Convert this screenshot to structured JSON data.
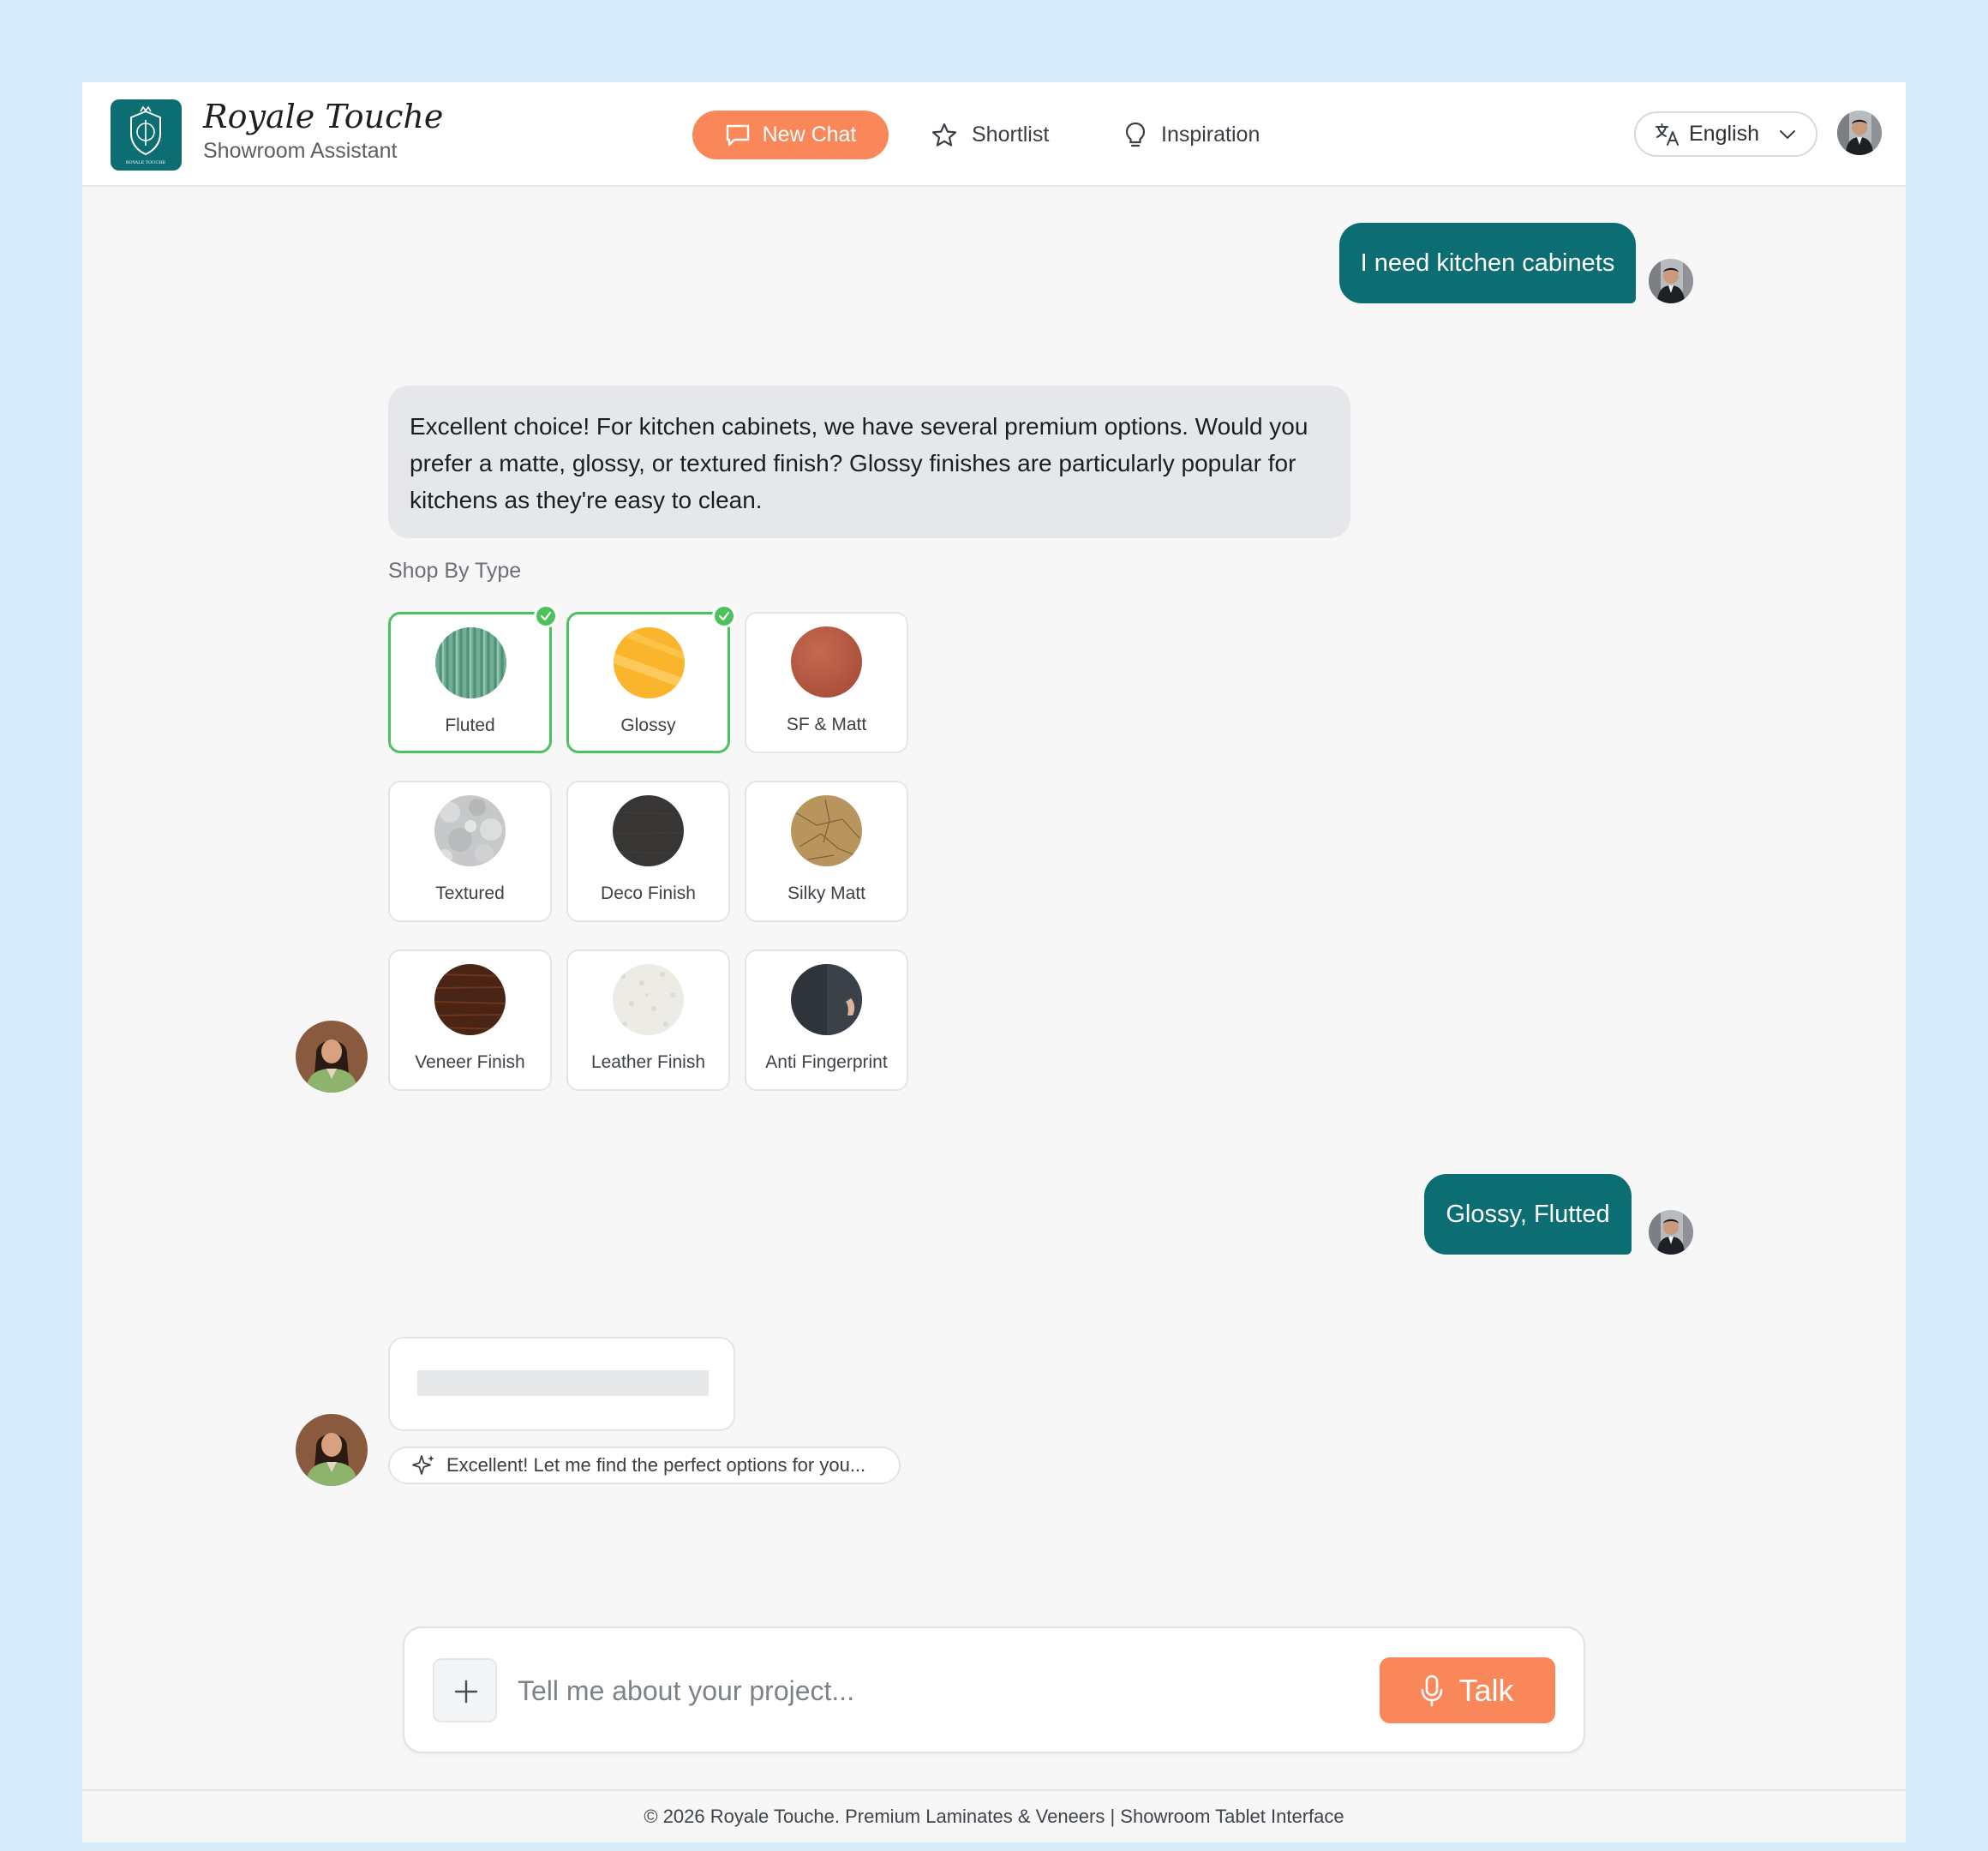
{
  "header": {
    "brand_title": "Royale Touche",
    "brand_subtitle": "Showroom Assistant",
    "logo_text": "ROYALE TOUCHE",
    "new_chat_label": "New Chat",
    "shortlist_label": "Shortlist",
    "inspiration_label": "Inspiration",
    "language_label": "English"
  },
  "messages": {
    "user_1": "I need kitchen cabinets",
    "bot_1": "Excellent choice! For kitchen cabinets, we have several premium options. Would you prefer a matte, glossy, or textured finish? Glossy finishes are particularly popular for kitchens as they're easy to clean.",
    "user_2": "Glossy, Flutted",
    "bot_typing": "Excellent! Let me find the perfect options for you..."
  },
  "shop_by_type": {
    "label": "Shop By Type",
    "items": [
      {
        "label": "Fluted",
        "selected": true
      },
      {
        "label": "Glossy",
        "selected": true
      },
      {
        "label": "SF & Matt",
        "selected": false
      },
      {
        "label": "Textured",
        "selected": false
      },
      {
        "label": "Deco Finish",
        "selected": false
      },
      {
        "label": "Silky Matt",
        "selected": false
      },
      {
        "label": "Veneer Finish",
        "selected": false
      },
      {
        "label": "Leather Finish",
        "selected": false
      },
      {
        "label": "Anti Fingerprint",
        "selected": false
      }
    ]
  },
  "composer": {
    "placeholder": "Tell me about your project...",
    "talk_label": "Talk"
  },
  "footer": {
    "text": "© 2026 Royale Touche. Premium Laminates & Veneers | Showroom Tablet Interface"
  },
  "colors": {
    "brand_teal": "#0c6e73",
    "accent_orange": "#f9875a",
    "selected_green": "#4cc15c",
    "page_background": "#d7ecfb"
  }
}
